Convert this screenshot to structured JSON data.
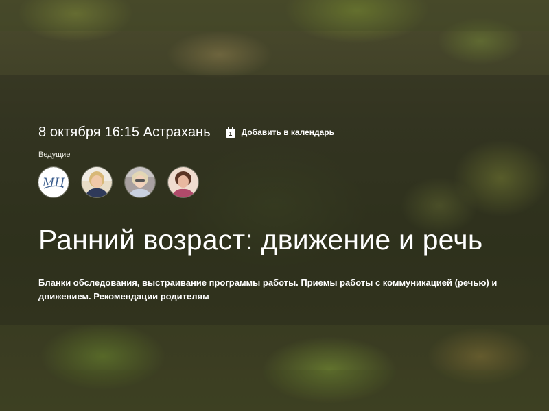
{
  "event": {
    "date_location": "8 октября 16:15 Астрахань",
    "calendar": {
      "icon": "calendar-icon",
      "icon_day": "1",
      "label": "Добавить в календарь"
    },
    "hosts_label": "Ведущие",
    "hosts": [
      {
        "kind": "logo",
        "logo_text": "МЦ"
      },
      {
        "kind": "photo"
      },
      {
        "kind": "photo"
      },
      {
        "kind": "photo"
      }
    ],
    "title": "Ранний возраст: движение и речь",
    "description": "Бланки обследования, выстраивание программы работы. Приемы работы с коммуникацией (речью) и движением. Рекомендации родителям"
  },
  "colors": {
    "background": "#3a3d26",
    "text": "#ffffff"
  }
}
